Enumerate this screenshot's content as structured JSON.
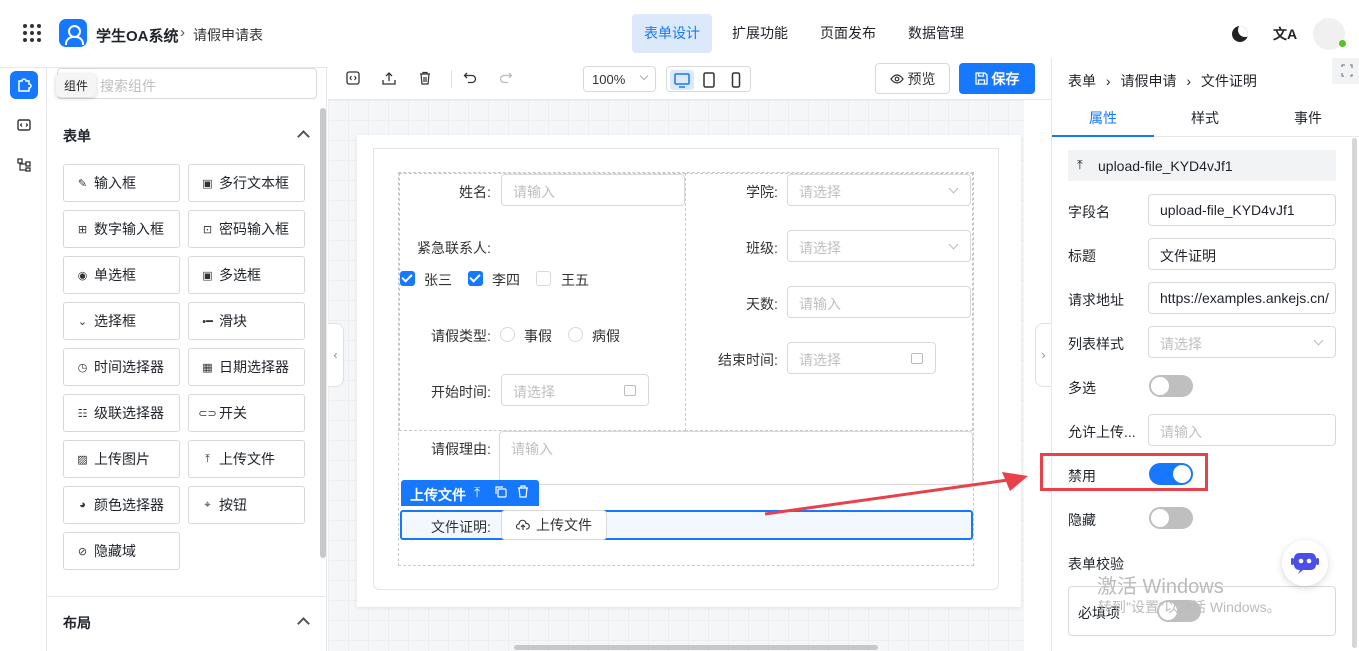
{
  "topbar": {
    "app_name": "学生OA系统",
    "breadcrumb_sep": "›",
    "page_name": "请假申请表",
    "nav": [
      "表单设计",
      "扩展功能",
      "页面发布",
      "数据管理"
    ],
    "translate_glyph": "文A"
  },
  "components": {
    "tooltip": "组件",
    "search_placeholder": "搜索组件",
    "section_form": "表单",
    "section_layout": "布局",
    "items": [
      {
        "label": "输入框",
        "icon": "pencil-icon",
        "glyph": "✎"
      },
      {
        "label": "多行文本框",
        "icon": "textarea-icon",
        "glyph": "▣"
      },
      {
        "label": "数字输入框",
        "icon": "number-icon",
        "glyph": "⊞"
      },
      {
        "label": "密码输入框",
        "icon": "lock-icon",
        "glyph": "⊡"
      },
      {
        "label": "单选框",
        "icon": "radio-icon",
        "glyph": "◉"
      },
      {
        "label": "多选框",
        "icon": "checkbox-icon",
        "glyph": "▣"
      },
      {
        "label": "选择框",
        "icon": "select-icon",
        "glyph": "⌄"
      },
      {
        "label": "滑块",
        "icon": "slider-icon",
        "glyph": "•━"
      },
      {
        "label": "时间选择器",
        "icon": "clock-icon",
        "glyph": "◷"
      },
      {
        "label": "日期选择器",
        "icon": "calendar-icon",
        "glyph": "▦"
      },
      {
        "label": "级联选择器",
        "icon": "cascader-icon",
        "glyph": "☷"
      },
      {
        "label": "开关",
        "icon": "switch-icon",
        "glyph": "⊂⊃"
      },
      {
        "label": "上传图片",
        "icon": "image-icon",
        "glyph": "▨"
      },
      {
        "label": "上传文件",
        "icon": "upload-icon",
        "glyph": "⤒"
      },
      {
        "label": "颜色选择器",
        "icon": "palette-icon",
        "glyph": "◕"
      },
      {
        "label": "按钮",
        "icon": "button-icon",
        "glyph": "⌖"
      },
      {
        "label": "隐藏域",
        "icon": "eye-off-icon",
        "glyph": "⊘"
      }
    ]
  },
  "toolbar": {
    "zoom": "100%",
    "preview": "预览",
    "save": "保存"
  },
  "form": {
    "name_label": "姓名:",
    "name_placeholder": "请输入",
    "college_label": "学院:",
    "college_placeholder": "请选择",
    "contact_label": "紧急联系人:",
    "contacts": [
      {
        "label": "张三",
        "checked": true
      },
      {
        "label": "李四",
        "checked": true
      },
      {
        "label": "王五",
        "checked": false
      }
    ],
    "class_label": "班级:",
    "class_placeholder": "请选择",
    "days_label": "天数:",
    "days_placeholder": "请输入",
    "leave_type_label": "请假类型:",
    "leave_types": [
      "事假",
      "病假"
    ],
    "end_label": "结束时间:",
    "end_placeholder": "请选择",
    "start_label": "开始时间:",
    "start_placeholder": "请选择",
    "reason_label": "请假理由:",
    "reason_placeholder": "请输入",
    "selected_tag": "上传文件",
    "file_label": "文件证明:",
    "upload_button": "上传文件"
  },
  "props": {
    "breadcrumb": [
      "表单",
      "请假申请",
      "文件证明"
    ],
    "tabs": [
      "属性",
      "样式",
      "事件"
    ],
    "component_id": "upload-file_KYD4vJf1",
    "fields": [
      {
        "label": "字段名",
        "value": "upload-file_KYD4vJf1",
        "placeholder": false
      },
      {
        "label": "标题",
        "value": "文件证明",
        "placeholder": false
      },
      {
        "label": "请求地址",
        "value": "https://examples.ankejs.cn/",
        "placeholder": false
      },
      {
        "label": "列表样式",
        "value": "请选择",
        "placeholder": true
      }
    ],
    "multi_label": "多选",
    "multi_on": false,
    "allow_label": "允许上传...",
    "allow_placeholder": "请输入",
    "disabled_label": "禁用",
    "disabled_on": true,
    "hidden_label": "隐藏",
    "hidden_on": false,
    "validation_label": "表单校验",
    "required_label": "必填项",
    "required_on": false
  },
  "watermark": {
    "line1": "激活 Windows",
    "line2": "转到\"设置\"以激活 Windows。"
  },
  "colors": {
    "accent": "#1677ff",
    "highlight": "#e8414b"
  }
}
